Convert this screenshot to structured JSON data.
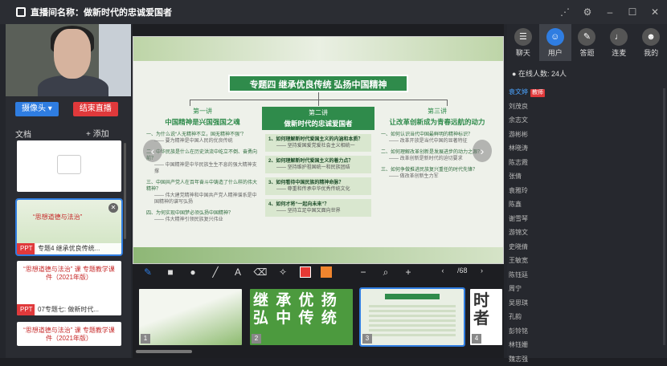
{
  "window": {
    "title": "直播间名称：做新时代的忠诚爱国者"
  },
  "left": {
    "camera_btn": "摄像头",
    "end_btn": "结束直播",
    "doc_label": "文档",
    "add_label": "+ 添加",
    "thumbs": [
      {
        "tag": "PPT",
        "name": "专题4 继承优良传统..."
      },
      {
        "tag": "PPT",
        "name": "07专题七: 做新时代..."
      }
    ],
    "thumb_titles": [
      "“思想道德与法治” 课\n专题教学课件（2021年版）",
      "“思想道德与法治” 课\n专题教学课件（2021年版）"
    ]
  },
  "slide": {
    "title": "专题四  继承优良传统  弘扬中国精神",
    "col1": {
      "head1": "第一讲",
      "head2": "中国精神是兴国强国之魂",
      "items": [
        {
          "q": "一、为什么说“人无精神不立，国无精神不强”？",
          "a": "—— 要为精神是中国人民的优良传统"
        },
        {
          "q": "二、中华民族是什么在历史洪流中屹立不倒、奋勇向前？",
          "a": "—— 中国精神是中华民族生生不息的强大精神支撑"
        },
        {
          "q": "三、中国共产党人在百年奋斗中铸造了什么样的伟大精神？",
          "a": "—— 伟大建党精神和中国共产党人精神谱系是中国精神的谱写弘扬"
        },
        {
          "q": "四、为何实现中国梦必须弘扬中国精神？",
          "a": "—— 伟大精神引领民族复兴伟业"
        }
      ]
    },
    "col2": {
      "head1": "第二讲",
      "head2": "做新时代的忠诚爱国者",
      "items": [
        {
          "q": "1、如何理解新时代爱国主义的内涵和本质？",
          "a": "—— 坚持爱国爱党爱社会主义相统一"
        },
        {
          "q": "2、如何理解新时代爱国主义的着力点？",
          "a": "—— 坚持维护祖国统一和民族团结"
        },
        {
          "q": "3、如何看待中国民族的精神命脉？",
          "a": "—— 尊重和传承中华优秀传统文化"
        },
        {
          "q": "4、如何才将“一起向未来”？",
          "a": "—— 坚持立足中国又面向世界"
        }
      ]
    },
    "col3": {
      "head1": "第三讲",
      "head2": "让改革创新成为青春远航的动力",
      "items": [
        {
          "q": "一、如何认识当代中国最鲜明的精神标识？",
          "a": "—— 改革开放是当代中国的显著特征"
        },
        {
          "q": "二、如何理解改革创新是发展进步的动力之源？",
          "a": "—— 改革创新是新时代的迫切要求"
        },
        {
          "q": "三、如何争做推进民族复兴重任的时代先锋？",
          "a": "—— 做改革创新生力军"
        }
      ]
    }
  },
  "toolbar": {
    "page": "/68",
    "colors": {
      "red": "#e53935",
      "orange": "#f0852e"
    }
  },
  "film": {
    "nums": [
      "1",
      "2",
      "3",
      "4"
    ],
    "big_chars": "继 承 优 扬 弘 中 传 统"
  },
  "right": {
    "tabs": [
      {
        "icon": "chat-icon",
        "label": "聊天"
      },
      {
        "icon": "users-icon",
        "label": "用户"
      },
      {
        "icon": "pen-icon",
        "label": "答题"
      },
      {
        "icon": "mic-icon",
        "label": "连麦"
      },
      {
        "icon": "person-icon",
        "label": "我的"
      }
    ],
    "online": "在线人数: 24人",
    "self_name": "袁文婷",
    "self_badge": "教师",
    "users": [
      "刘茂良",
      "余志文",
      "游彬彬",
      "林晓涛",
      "陈志霞",
      "张倩",
      "袁雅玲",
      "陈鑫",
      "谢雪琴",
      "游锦文",
      "史晓倩",
      "王敏宽",
      "陈钰廷",
      "周宁",
      "吴思琪",
      "孔韵",
      "彭铃铭",
      "林钰姗",
      "魏志强"
    ]
  }
}
